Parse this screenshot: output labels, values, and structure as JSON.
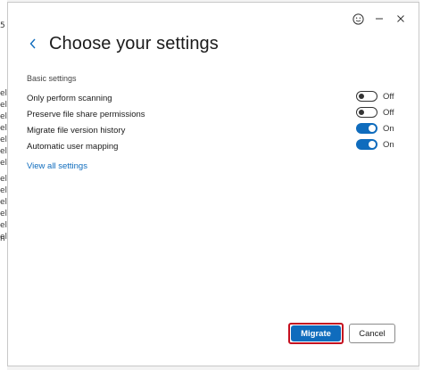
{
  "background": {
    "left_letters": [
      "5",
      "el",
      "el",
      "el",
      "el",
      "el",
      "el",
      "el",
      "el",
      "el",
      "el",
      "el",
      "el",
      "el",
      "n"
    ]
  },
  "window_controls": {
    "feedback_icon": "smiley-icon",
    "minimize_icon": "minimize-icon",
    "close_icon": "close-icon"
  },
  "header": {
    "back_icon": "chevron-left-icon",
    "title": "Choose your settings"
  },
  "section": {
    "label": "Basic settings"
  },
  "settings": [
    {
      "label": "Only perform scanning",
      "state": "Off",
      "on": false
    },
    {
      "label": "Preserve file share permissions",
      "state": "Off",
      "on": false
    },
    {
      "label": "Migrate file version history",
      "state": "On",
      "on": true
    },
    {
      "label": "Automatic user mapping",
      "state": "On",
      "on": true
    }
  ],
  "link": {
    "label": "View all settings"
  },
  "footer": {
    "primary_label": "Migrate",
    "secondary_label": "Cancel"
  },
  "colors": {
    "accent": "#0f6cbd",
    "highlight_border": "#c50f1f"
  }
}
